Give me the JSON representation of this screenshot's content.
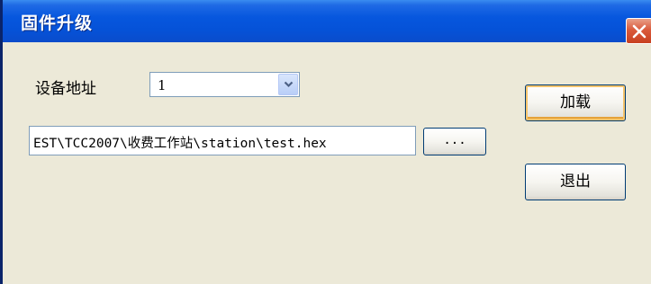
{
  "window": {
    "title": "固件升级",
    "close_icon": "close-icon"
  },
  "device_address": {
    "label": "设备地址",
    "selected_value": "1"
  },
  "file_path": {
    "value": "EST\\TCC2007\\收费工作站\\station\\test.hex"
  },
  "buttons": {
    "browse_label": "...",
    "load_label": "加载",
    "exit_label": "退出"
  },
  "colors": {
    "titlebar": "#0552D8",
    "close_button": "#DA5A3C",
    "dialog_background": "#ECE9D8",
    "default_button_focus": "#F5C46C"
  }
}
